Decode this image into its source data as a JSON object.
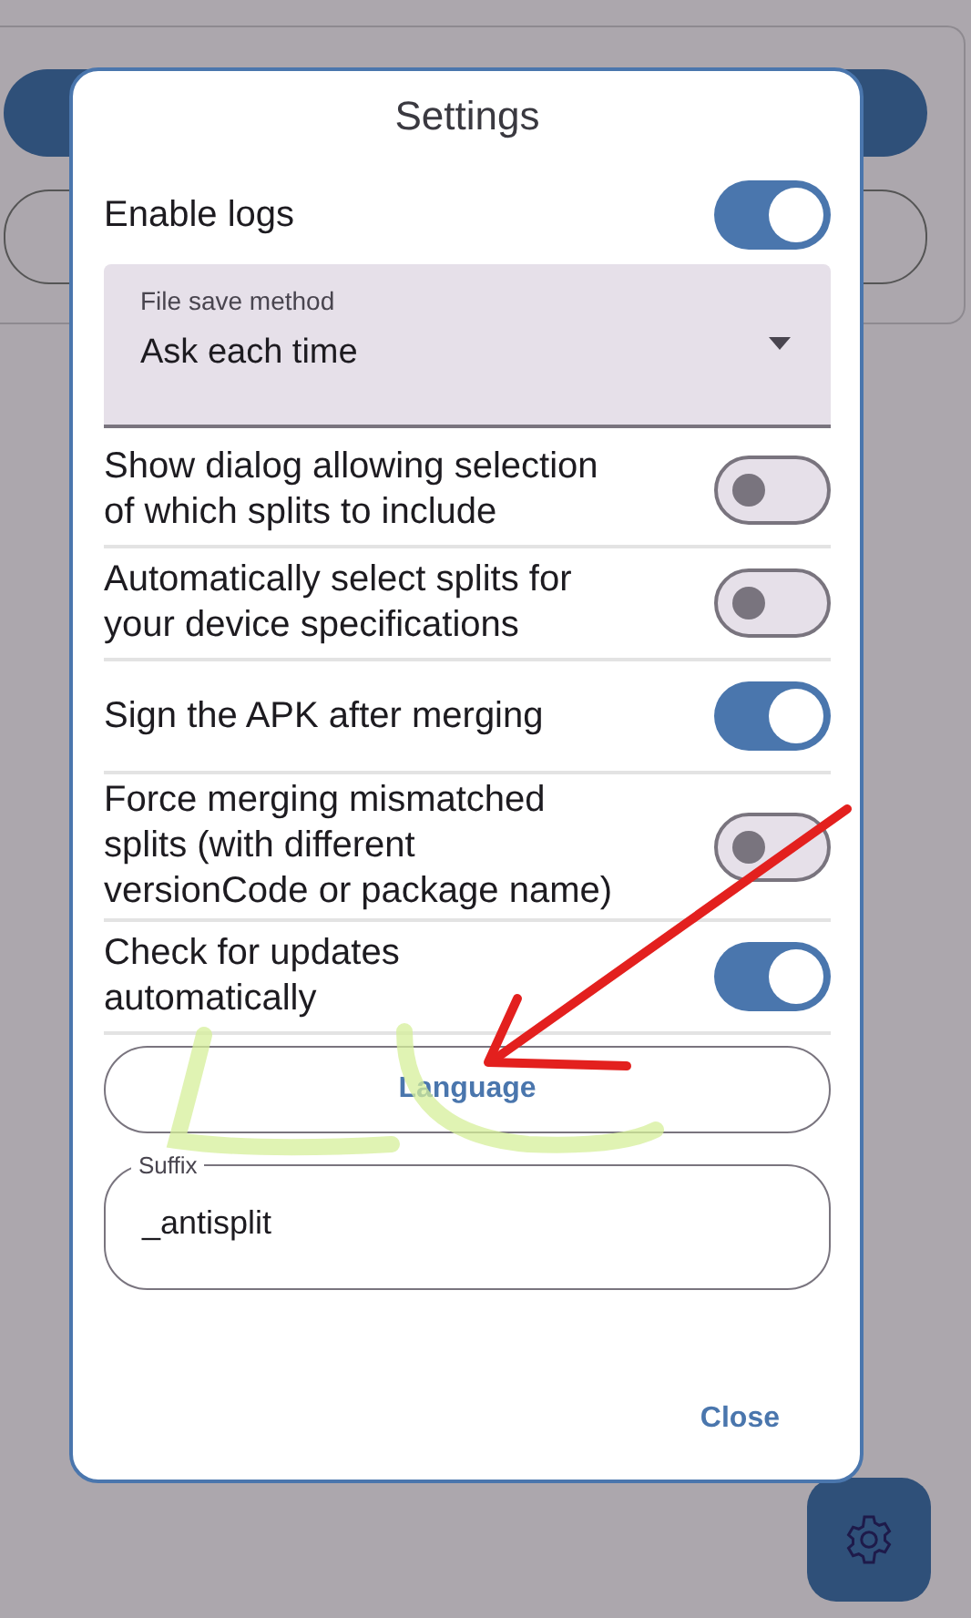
{
  "dialog": {
    "title": "Settings",
    "settings": [
      {
        "kind": "toggle",
        "label": "Enable logs",
        "on": true
      },
      {
        "kind": "dropdown",
        "label": "File save method",
        "value": "Ask each time"
      },
      {
        "kind": "toggle",
        "label": "Show dialog allowing selection of which splits to include",
        "on": false
      },
      {
        "kind": "toggle",
        "label": "Automatically select splits for your device specifications",
        "on": false
      },
      {
        "kind": "toggle",
        "label": "Sign the APK after merging",
        "on": true
      },
      {
        "kind": "toggle",
        "label": "Force merging mismatched splits (with different versionCode or package name)",
        "on": false
      },
      {
        "kind": "toggle",
        "label": "Check for updates automatically",
        "on": true
      }
    ],
    "language_button": "Language",
    "suffix_field": {
      "label": "Suffix",
      "value": "_antisplit"
    },
    "close_button": "Close"
  }
}
